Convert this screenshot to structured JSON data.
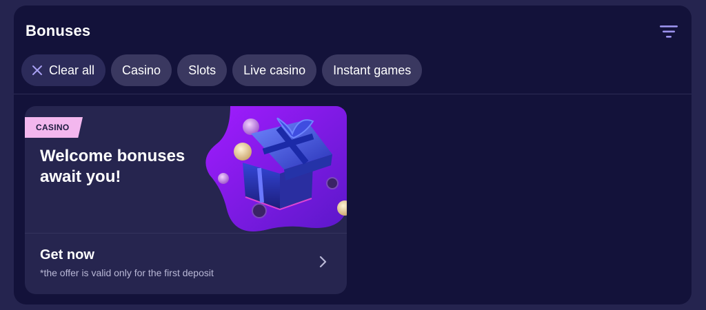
{
  "header": {
    "title": "Bonuses",
    "filter_icon": "filter-lines-icon"
  },
  "chips": {
    "clear_all": "Clear all",
    "clear_icon": "close-icon",
    "items": [
      "Casino",
      "Slots",
      "Live casino",
      "Instant games"
    ]
  },
  "card": {
    "badge": "CASINO",
    "title": "Welcome bonuses await you!",
    "cta": "Get now",
    "note": "*the offer is valid only for the first deposit",
    "chevron_icon": "chevron-right-icon",
    "image_icon": "gift-box-illustration"
  },
  "colors": {
    "background": "#25244f",
    "panel": "#13123a",
    "chip": "#3a3860",
    "card": "#26254f",
    "badge": "#f3b7ee",
    "accent": "#8b5cf6"
  }
}
